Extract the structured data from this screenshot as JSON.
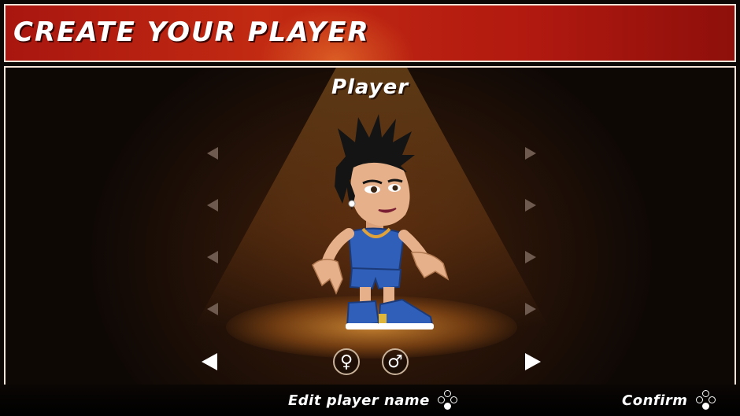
{
  "header": {
    "title": "CREATE YOUR PLAYER"
  },
  "stage": {
    "title": "Player"
  },
  "gender": {
    "female_symbol": "♀",
    "male_symbol": "♂"
  },
  "footer": {
    "edit_name_label": "Edit player name",
    "confirm_label": "Confirm"
  },
  "icons": {
    "female": "female-symbol-icon",
    "male": "male-symbol-icon",
    "controller_buttons": "controller-buttons-icon"
  },
  "colors": {
    "header_red": "#b31a10",
    "arrow_dim": "#6e5a4e",
    "arrow_active": "#ffffff",
    "jersey_blue": "#2f5fb8",
    "spotlight": "#e89a3c"
  }
}
